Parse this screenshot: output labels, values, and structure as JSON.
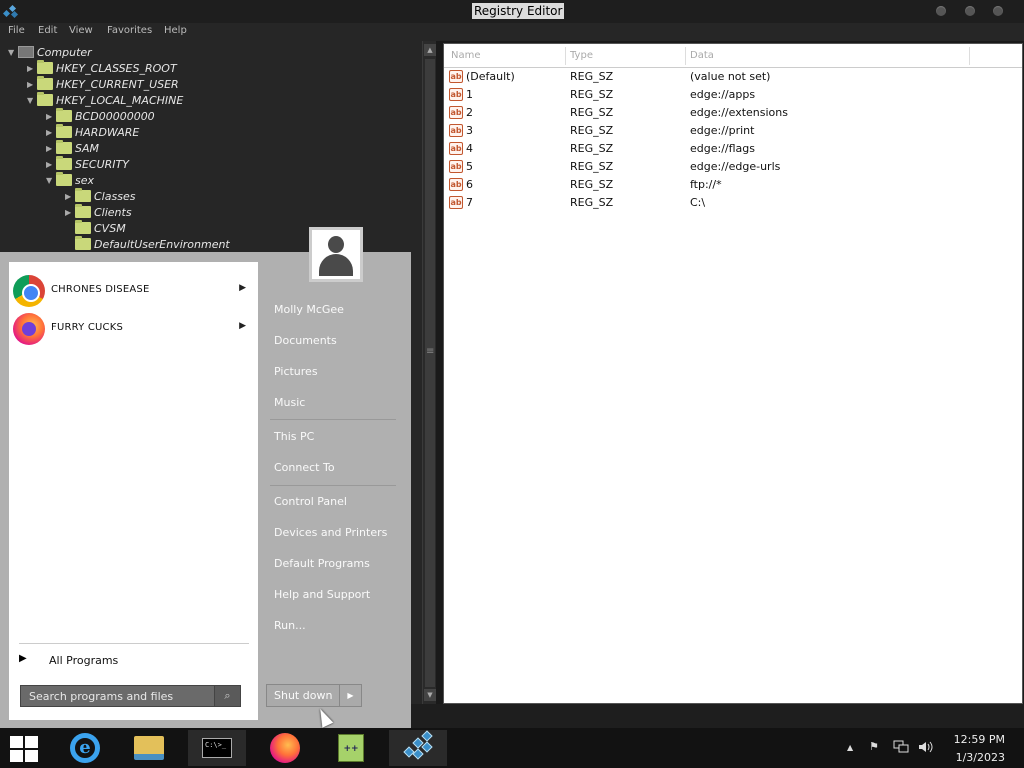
{
  "window": {
    "title": "Registry Editor",
    "menu": [
      "File",
      "Edit",
      "View",
      "Favorites",
      "Help"
    ]
  },
  "tree": {
    "items": [
      {
        "label": "Computer",
        "level": 0,
        "expanded": true,
        "icon": "computer-icon"
      },
      {
        "label": "HKEY_CLASSES_ROOT",
        "level": 1,
        "expanded": false,
        "icon": "folder-icon"
      },
      {
        "label": "HKEY_CURRENT_USER",
        "level": 1,
        "expanded": false,
        "icon": "folder-icon"
      },
      {
        "label": "HKEY_LOCAL_MACHINE",
        "level": 1,
        "expanded": true,
        "icon": "folder-icon"
      },
      {
        "label": "BCD00000000",
        "level": 2,
        "expanded": false,
        "icon": "folder-icon"
      },
      {
        "label": "HARDWARE",
        "level": 2,
        "expanded": false,
        "icon": "folder-icon"
      },
      {
        "label": "SAM",
        "level": 2,
        "expanded": false,
        "icon": "folder-icon"
      },
      {
        "label": "SECURITY",
        "level": 2,
        "expanded": false,
        "icon": "folder-icon"
      },
      {
        "label": "sex",
        "level": 2,
        "expanded": true,
        "icon": "folder-icon"
      },
      {
        "label": "Classes",
        "level": 3,
        "expanded": false,
        "icon": "folder-icon"
      },
      {
        "label": "Clients",
        "level": 3,
        "expanded": false,
        "icon": "folder-icon"
      },
      {
        "label": "CVSM",
        "level": 3,
        "expanded": false,
        "icon": "folder-icon"
      },
      {
        "label": "DefaultUserEnvironment",
        "level": 3,
        "expanded": false,
        "icon": "folder-icon"
      }
    ]
  },
  "values": {
    "headers": [
      "Name",
      "Type",
      "Data"
    ],
    "rows": [
      {
        "name": "(Default)",
        "type": "REG_SZ",
        "data": "(value not set)"
      },
      {
        "name": "1",
        "type": "REG_SZ",
        "data": "edge://apps"
      },
      {
        "name": "2",
        "type": "REG_SZ",
        "data": "edge://extensions"
      },
      {
        "name": "3",
        "type": "REG_SZ",
        "data": "edge://print"
      },
      {
        "name": "4",
        "type": "REG_SZ",
        "data": "edge://flags"
      },
      {
        "name": "5",
        "type": "REG_SZ",
        "data": "edge://edge-urls"
      },
      {
        "name": "6",
        "type": "REG_SZ",
        "data": "ftp://*"
      },
      {
        "name": "7",
        "type": "REG_SZ",
        "data": "C:\\"
      }
    ]
  },
  "start_menu": {
    "pinned": [
      {
        "label": "CHRONES DISEASE",
        "icon": "chrome-icon"
      },
      {
        "label": "FURRY CUCKS",
        "icon": "firefox-icon"
      }
    ],
    "all_programs": "All Programs",
    "search_placeholder": "Search programs and files",
    "user_name": "Molly McGee",
    "right_items": [
      "Documents",
      "Pictures",
      "Music",
      "This PC",
      "Connect To",
      "Control Panel",
      "Devices and Printers",
      "Default Programs",
      "Help and Support",
      "Run..."
    ],
    "shutdown": "Shut down"
  },
  "taskbar": {
    "apps": [
      "internet-explorer-icon",
      "file-explorer-icon",
      "command-prompt-icon",
      "firefox-icon",
      "notepad-plus-plus-icon",
      "registry-editor-icon"
    ],
    "cmd_text": "C:\\>_",
    "npp_text": "++",
    "time": "12:59 PM",
    "date": "1/3/2023"
  }
}
